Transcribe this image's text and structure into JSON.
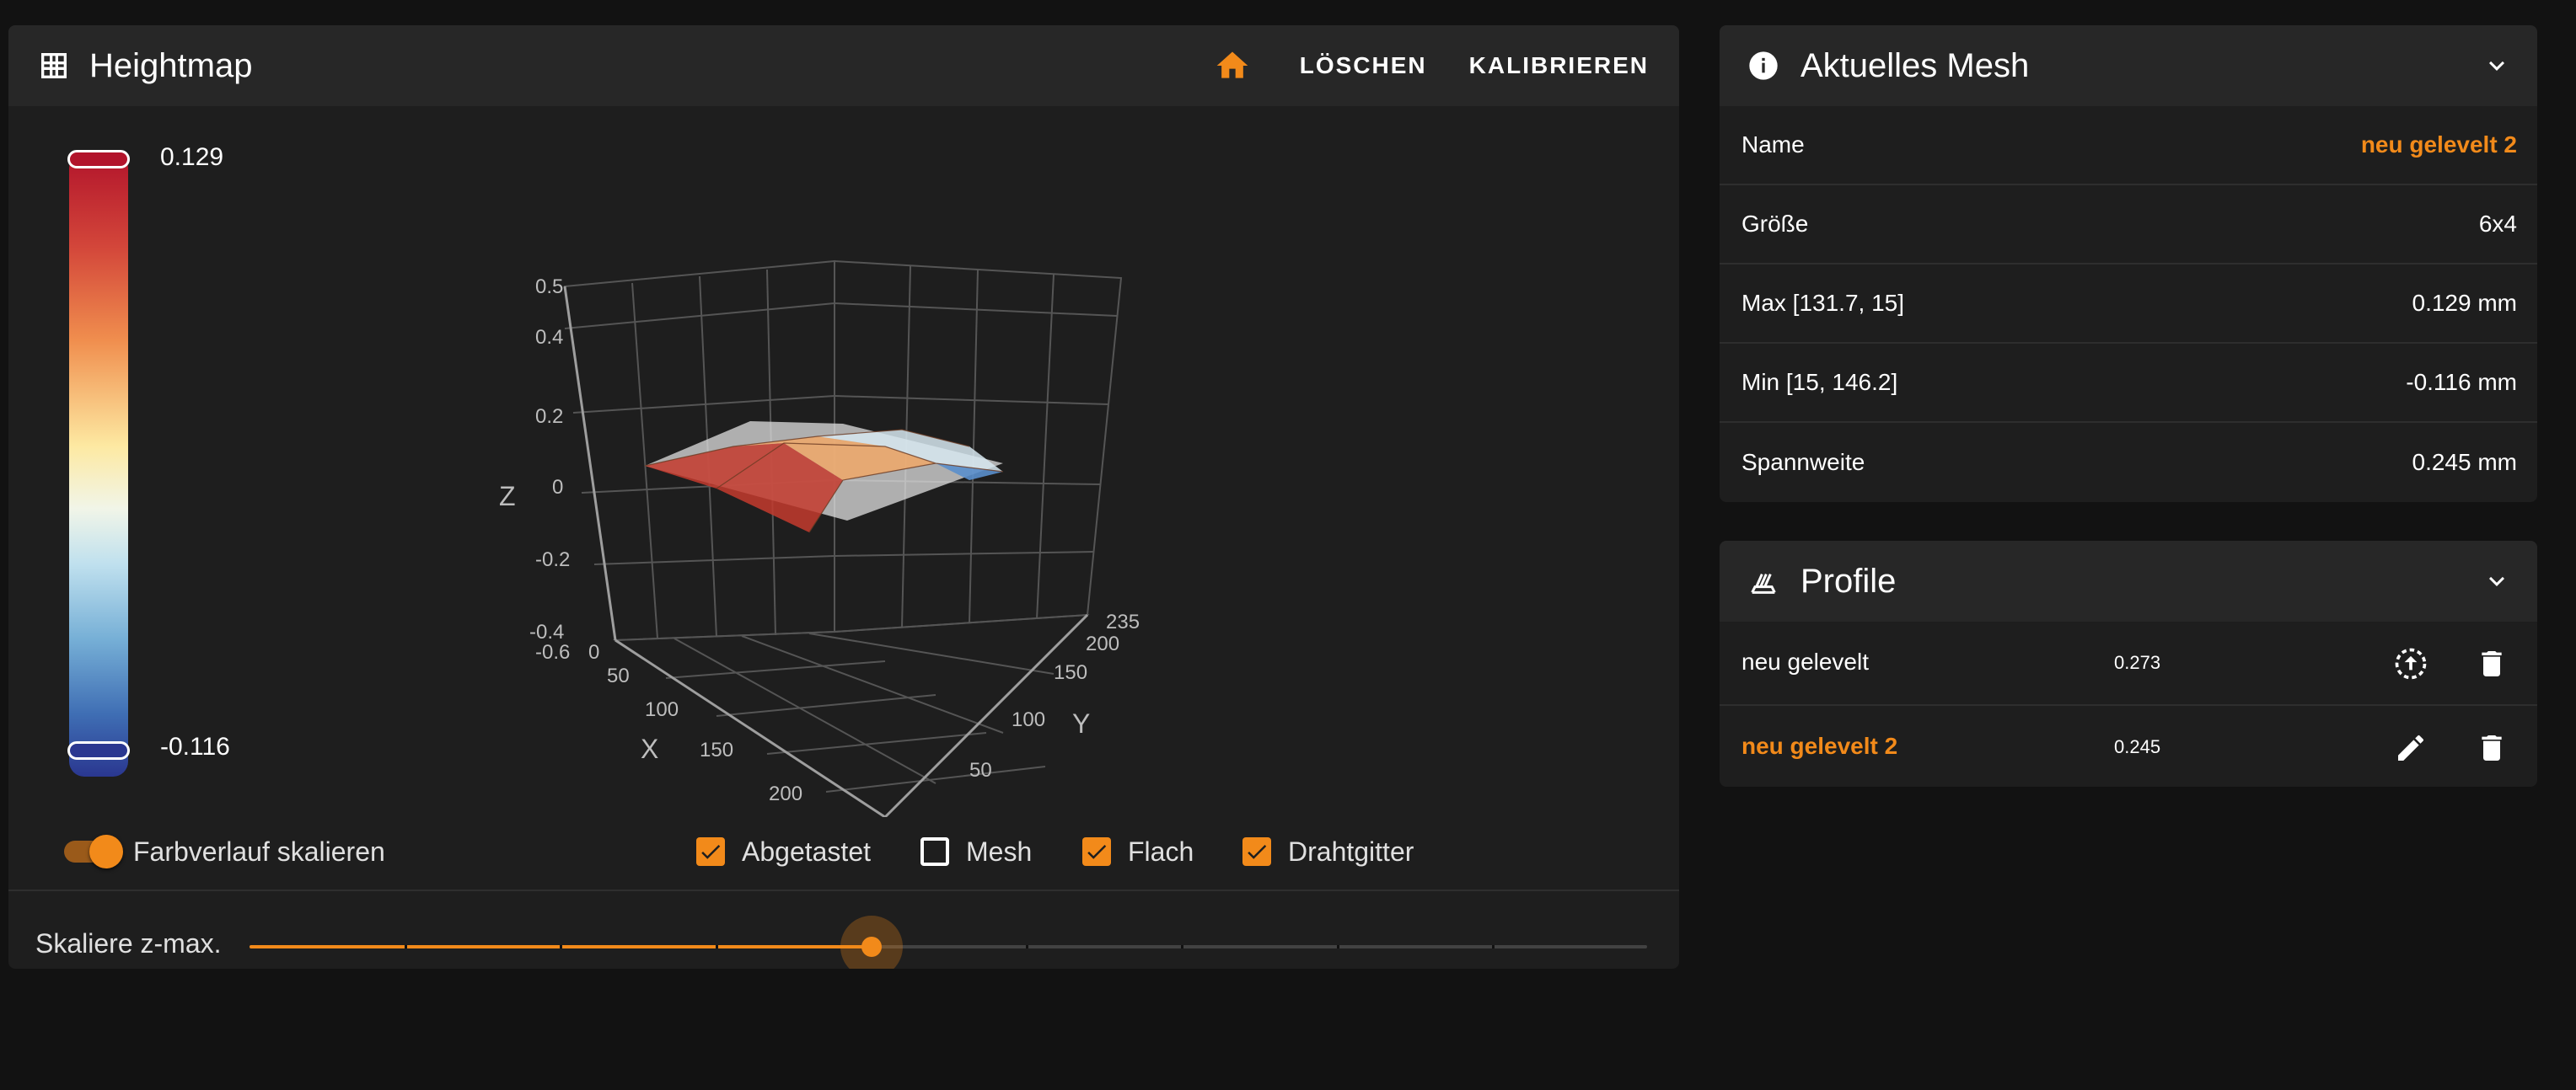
{
  "heightmap": {
    "title": "Heightmap",
    "icon": "grid-icon",
    "actions": {
      "home_icon": "home-icon",
      "clear_label": "LÖSCHEN",
      "calibrate_label": "KALIBRIEREN"
    },
    "colorbar": {
      "max_label": "0.129",
      "min_label": "-0.116",
      "gradient": [
        "#b2142b",
        "#d3463a",
        "#f08e4e",
        "#fde9a2",
        "#f1f5e8",
        "#bfe0ee",
        "#76afd6",
        "#3f6eb4",
        "#2a3790"
      ]
    },
    "plot": {
      "z_label": "Z",
      "x_label": "X",
      "y_label": "Y",
      "z_ticks": [
        "0.5",
        "0.4",
        "0.2",
        "0",
        "-0.2",
        "-0.4",
        "-0.6"
      ],
      "x_ticks": [
        "0",
        "50",
        "100",
        "150",
        "200"
      ],
      "y_ticks": [
        "50",
        "100",
        "150",
        "200",
        "235"
      ],
      "x_range": [
        0,
        235
      ],
      "y_range": [
        0,
        235
      ],
      "z_range": [
        -0.6,
        0.5
      ]
    },
    "options": {
      "scale_gradient_label": "Farbverlauf skalieren",
      "scale_gradient_on": true,
      "probed_label": "Abgetastet",
      "probed_checked": true,
      "mesh_label": "Mesh",
      "mesh_checked": false,
      "flat_label": "Flach",
      "flat_checked": true,
      "wireframe_label": "Drahtgitter",
      "wireframe_checked": true
    },
    "slider": {
      "label": "Skaliere z-max.",
      "value_fraction": 0.445,
      "steps": 9
    }
  },
  "current_mesh": {
    "title": "Aktuelles Mesh",
    "icon": "info-icon",
    "rows": [
      {
        "key": "Name",
        "value": "neu gelevelt 2",
        "accent": true
      },
      {
        "key": "Größe",
        "value": "6x4",
        "accent": false
      },
      {
        "key": "Max [131.7, 15]",
        "value": "0.129 mm",
        "accent": false
      },
      {
        "key": "Min [15, 146.2]",
        "value": "-0.116 mm",
        "accent": false
      },
      {
        "key": "Spannweite",
        "value": "0.245 mm",
        "accent": false
      }
    ]
  },
  "profiles": {
    "title": "Profile",
    "icon": "layers-icon",
    "items": [
      {
        "name": "neu gelevelt",
        "value": "0.273",
        "active": false,
        "action_icon": "load-icon",
        "delete_icon": "delete-icon"
      },
      {
        "name": "neu gelevelt 2",
        "value": "0.245",
        "active": true,
        "action_icon": "edit-icon",
        "delete_icon": "delete-icon"
      }
    ]
  },
  "colors": {
    "accent": "#f28a1a",
    "background": "#121212",
    "card": "#1e1e1e",
    "card_header": "#272727"
  }
}
